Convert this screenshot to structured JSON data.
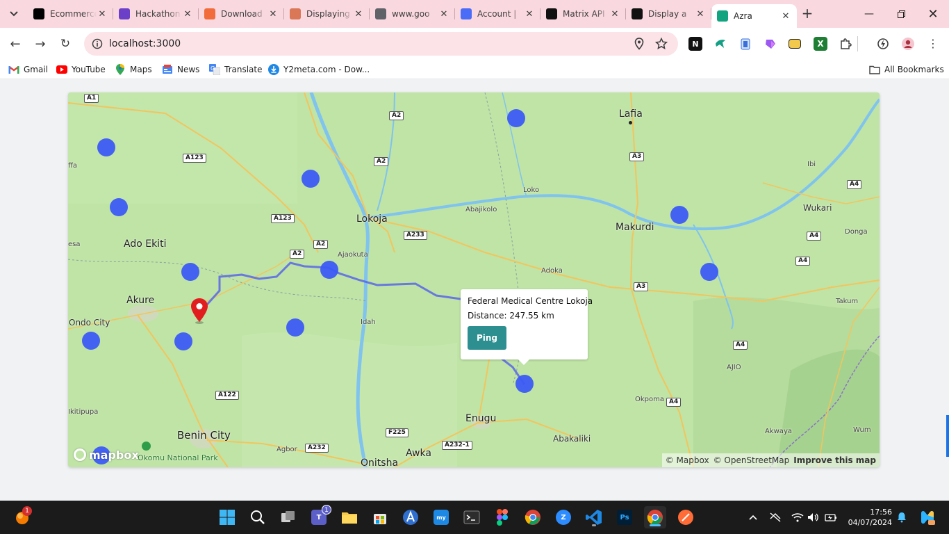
{
  "browser": {
    "tabs": [
      {
        "title": "Ecommerce",
        "icon": "notion-style-icon",
        "color": "#000000"
      },
      {
        "title": "Hackathon",
        "icon": "puzzle-icon",
        "color": "#6c3fc9"
      },
      {
        "title": "Download",
        "icon": "download-icon",
        "color": "#f26b3a"
      },
      {
        "title": "Displaying",
        "icon": "claude-icon",
        "color": "#d97757"
      },
      {
        "title": "www.goo",
        "icon": "globe-icon",
        "color": "#5f6368"
      },
      {
        "title": "Account |",
        "icon": "account-icon",
        "color": "#4a6cf7"
      },
      {
        "title": "Matrix API",
        "icon": "matrix-icon",
        "color": "#111111"
      },
      {
        "title": "Display a",
        "icon": "display-icon",
        "color": "#111111"
      },
      {
        "title": "Azra",
        "icon": "azra-icon",
        "color": "#12a37f",
        "active": true
      }
    ],
    "url": "localhost:3000",
    "bookmarks": [
      {
        "label": "Gmail",
        "icon": "gmail-icon"
      },
      {
        "label": "YouTube",
        "icon": "youtube-icon"
      },
      {
        "label": "Maps",
        "icon": "maps-icon"
      },
      {
        "label": "News",
        "icon": "news-icon"
      },
      {
        "label": "Translate",
        "icon": "translate-icon"
      },
      {
        "label": "Y2meta.com - Dow...",
        "icon": "download-icon"
      }
    ],
    "all_bookmarks": "All Bookmarks"
  },
  "map": {
    "places": {
      "lafia": "Lafia",
      "loko": "Loko",
      "ibi": "Ibi",
      "wukari": "Wukari",
      "donga": "Donga",
      "makurdi": "Makurdi",
      "takum": "Takum",
      "ajio": "AJIO",
      "okpoma": "Okpoma",
      "akwaya": "Akwaya",
      "wum": "Wum",
      "abakaliki": "Abakaliki",
      "enugu": "Enugu",
      "awka": "Awka",
      "onitsha": "Onitsha",
      "agbor": "Agbor",
      "benin_city": "Benin City",
      "akure": "Akure",
      "ondo_city": "Ondo City",
      "ado_ekiti": "Ado Ekiti",
      "lokoja": "Lokoja",
      "ajaokuta": "Ajaokuta",
      "abajikolo": "Abajikolo",
      "adoka": "Adoka",
      "idah": "Idah",
      "kitipupa": "Ikitipupa",
      "ffa": "ffa",
      "esa": "esa",
      "park": "Okomu National Park"
    },
    "roads": {
      "a1": "A1",
      "a2_top": "A2",
      "a2_mid": "A2",
      "a2_l": "A2",
      "a2_r": "A2",
      "a123_a": "A123",
      "a123_b": "A123",
      "a233": "A233",
      "a3_top": "A3",
      "a3_mid": "A3",
      "a4_a": "A4",
      "a4_b": "A4",
      "a4_c": "A4",
      "a4_d": "A4",
      "a4_e": "A4",
      "a122": "A122",
      "f225": "F225",
      "a232": "A232",
      "a232_1": "A232-1"
    },
    "popup": {
      "name": "Federal Medical Centre Lokoja",
      "distance": "Distance: 247.55 km",
      "button": "Ping"
    },
    "logo": "mapbox",
    "attribution": {
      "mapbox": "© Mapbox",
      "osm": "© OpenStreetMap",
      "improve": "Improve this map"
    }
  },
  "taskbar": {
    "notification_badge": "1",
    "teams_badge": "1",
    "time": "17:56",
    "date": "04/07/2024"
  }
}
